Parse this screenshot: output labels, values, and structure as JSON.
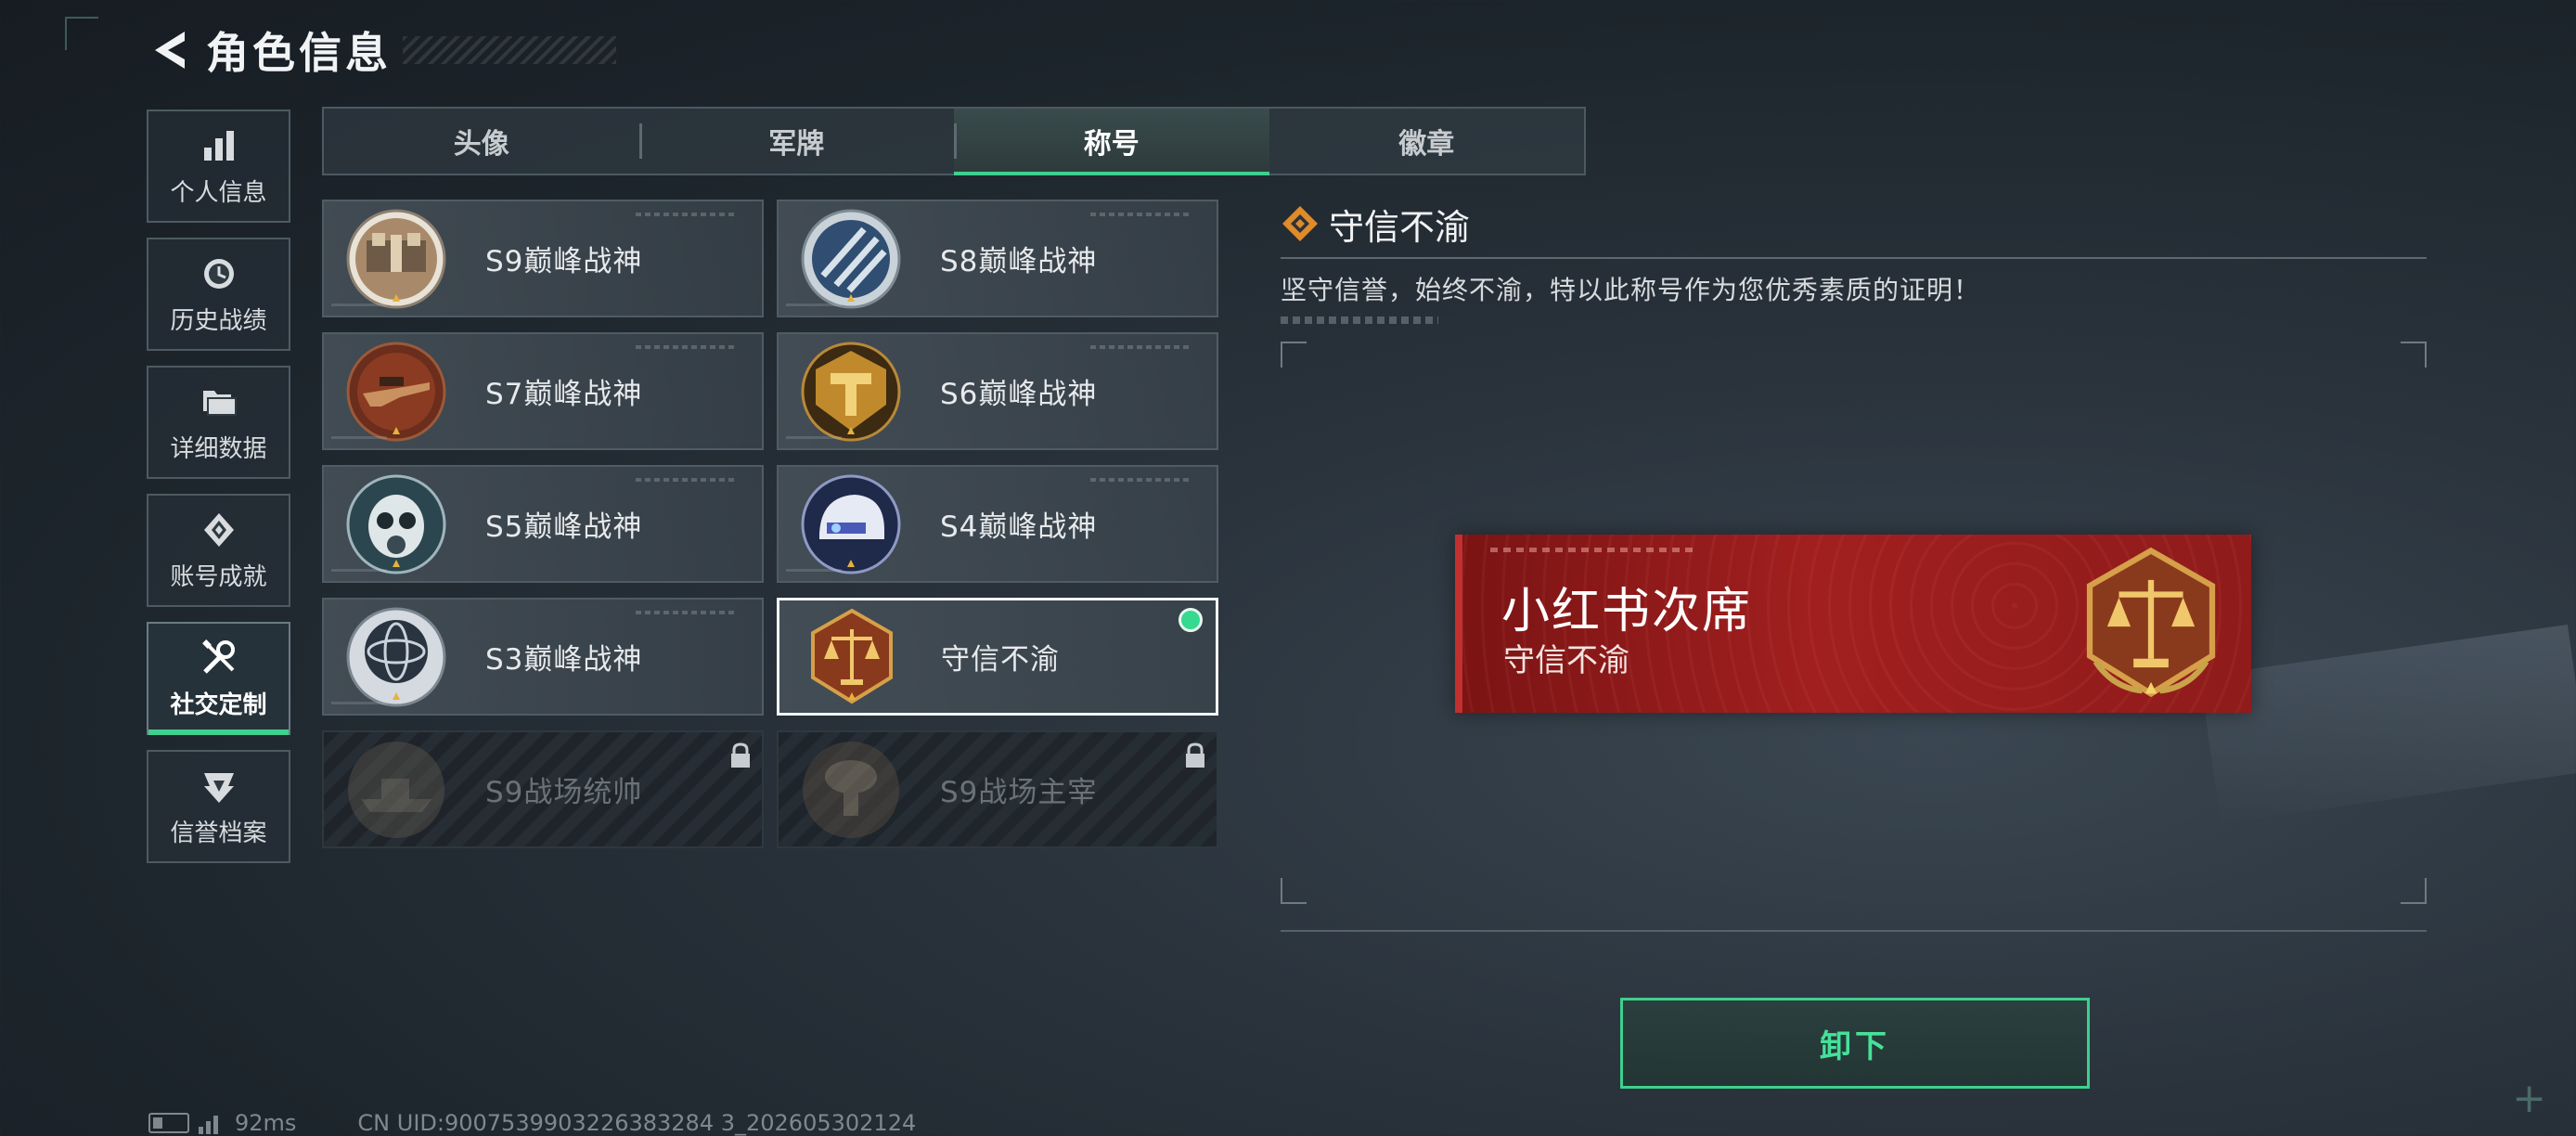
{
  "header": {
    "title": "角色信息"
  },
  "sidenav": {
    "items": [
      {
        "label": "个人信息",
        "icon": "bar-chart-icon"
      },
      {
        "label": "历史战绩",
        "icon": "history-clock-icon"
      },
      {
        "label": "详细数据",
        "icon": "folder-icon"
      },
      {
        "label": "账号成就",
        "icon": "achievement-icon"
      },
      {
        "label": "社交定制",
        "icon": "tools-icon",
        "active": true
      },
      {
        "label": "信誉档案",
        "icon": "shield-emblem-icon"
      }
    ]
  },
  "tabs": [
    {
      "label": "头像"
    },
    {
      "label": "军牌"
    },
    {
      "label": "称号",
      "active": true
    },
    {
      "label": "徽章"
    }
  ],
  "titles": [
    {
      "label": "S9巅峰战神",
      "medal": "fortress-medal-icon",
      "state": "normal"
    },
    {
      "label": "S8巅峰战神",
      "medal": "globe-stripes-medal-icon",
      "state": "normal"
    },
    {
      "label": "S7巅峰战神",
      "medal": "rifle-medal-icon",
      "state": "normal"
    },
    {
      "label": "S6巅峰战神",
      "medal": "gold-t-medal-icon",
      "state": "normal"
    },
    {
      "label": "S5巅峰战神",
      "medal": "gasmask-medal-icon",
      "state": "normal"
    },
    {
      "label": "S4巅峰战神",
      "medal": "helmet-medal-icon",
      "state": "normal"
    },
    {
      "label": "S3巅峰战神",
      "medal": "armillary-medal-icon",
      "state": "normal"
    },
    {
      "label": "守信不渝",
      "medal": "scales-medal-icon",
      "state": "selected",
      "equipped": true
    },
    {
      "label": "S9战场统帅",
      "medal": "warship-medal-icon",
      "state": "locked"
    },
    {
      "label": "S9战场主宰",
      "medal": "mushroom-cloud-medal-icon",
      "state": "locked"
    }
  ],
  "detail": {
    "title": "守信不渝",
    "description": "坚守信誉，始终不渝，特以此称号作为您优秀素质的证明！",
    "nameplate": {
      "player_name": "小红书次席",
      "title": "守信不渝"
    }
  },
  "actions": {
    "unequip_label": "卸下"
  },
  "status": {
    "ping": "92ms",
    "uid": "CN UID:9007539903226383284 3_202605302124"
  },
  "colors": {
    "accent_green": "#3fcf8e",
    "nameplate_red": "#a11f1f",
    "medal_bronze": "#b05a2a"
  }
}
